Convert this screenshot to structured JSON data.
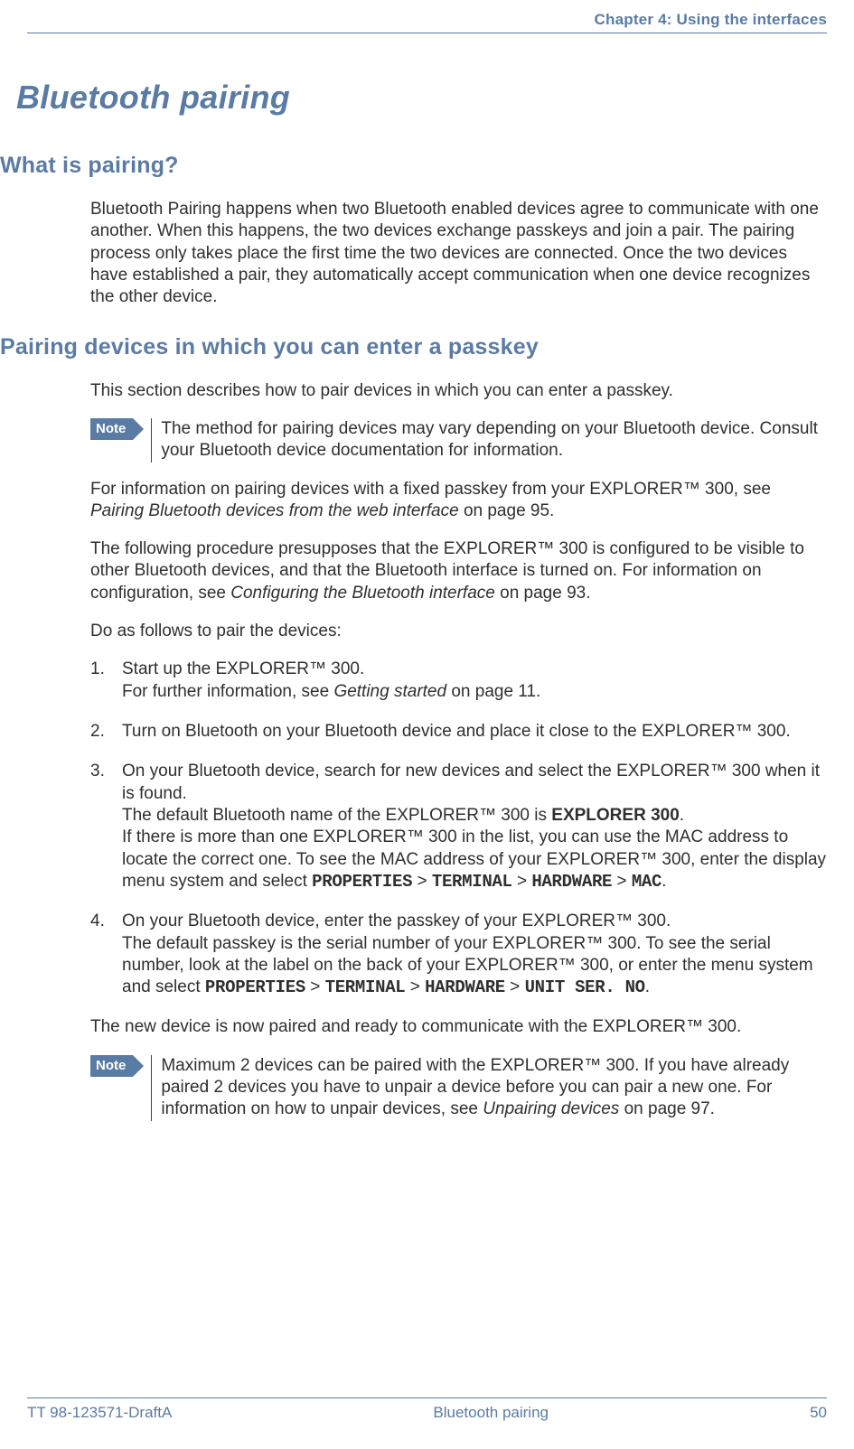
{
  "chapter_header": "Chapter 4: Using the interfaces",
  "title": "Bluetooth pairing",
  "sections": {
    "s1": {
      "heading": "What is pairing?",
      "p1": "Bluetooth Pairing happens when two Bluetooth enabled devices agree to communicate with one another. When this happens, the two devices exchange passkeys and join a pair. The pairing process only takes place the first time the two devices are connected. Once the two devices have established a pair, they automatically accept communication when one device recognizes the other device."
    },
    "s2": {
      "heading": "Pairing devices in which you can enter a passkey",
      "p1": "This section describes how to pair devices in which you can enter a passkey.",
      "note1_label": "Note",
      "note1_text": "The method for pairing devices may vary depending on your Bluetooth device. Consult your Bluetooth device documentation for information.",
      "p2_a": "For information on pairing devices with a fixed passkey from your EXPLORER™ 300, see ",
      "p2_i": "Pairing Bluetooth devices from the web interface",
      "p2_b": " on page 95.",
      "p3_a": "The following procedure presupposes that the EXPLORER™ 300 is configured to be visible to other Bluetooth devices, and that the Bluetooth interface is turned on. For information on configuration, see ",
      "p3_i": "Configuring the Bluetooth interface",
      "p3_b": " on page 93.",
      "p4": "Do as follows to pair the devices:",
      "step1_a": "Start up the EXPLORER™ 300.",
      "step1_b": "For further information, see ",
      "step1_i": "Getting started",
      "step1_c": " on page 11.",
      "step2": "Turn on Bluetooth on your Bluetooth device and place it close to the EXPLORER™ 300.",
      "step3_a": "On your Bluetooth device, search for new devices and select the EXPLORER™ 300 when it is found.",
      "step3_b": "The default Bluetooth name of the EXPLORER™ 300 is ",
      "step3_bold": "EXPLORER 300",
      "step3_b2": ".",
      "step3_c": "If there is more than one EXPLORER™ 300 in the list, you can use the MAC address to locate the correct one. To see the MAC address of your EXPLORER™ 300, enter the display menu system and select ",
      "m_props": "PROPERTIES",
      "gt": " > ",
      "m_term": "TERMINAL",
      "m_hw": "HARDWARE",
      "m_mac": "MAC",
      "dot": ".",
      "step4_a": "On your Bluetooth device, enter the passkey of your EXPLORER™ 300.",
      "step4_b": "The default passkey is the serial number of your EXPLORER™ 300. To see the serial number, look at the label on the back of your EXPLORER™ 300, or enter the menu system and select ",
      "m_unit": "UNIT SER. NO",
      "p5": "The new device is now paired and ready to communicate with the EXPLORER™ 300.",
      "note2_label": "Note",
      "note2_a": "Maximum 2 devices can be paired with the EXPLORER™ 300. If you have already paired 2 devices you have to unpair a device before you can pair a new one. For information on how to unpair devices, see ",
      "note2_i": "Unpairing devices",
      "note2_b": " on page 97."
    }
  },
  "footer": {
    "left": "TT 98-123571-DraftA",
    "center": "Bluetooth pairing",
    "right": "50"
  }
}
